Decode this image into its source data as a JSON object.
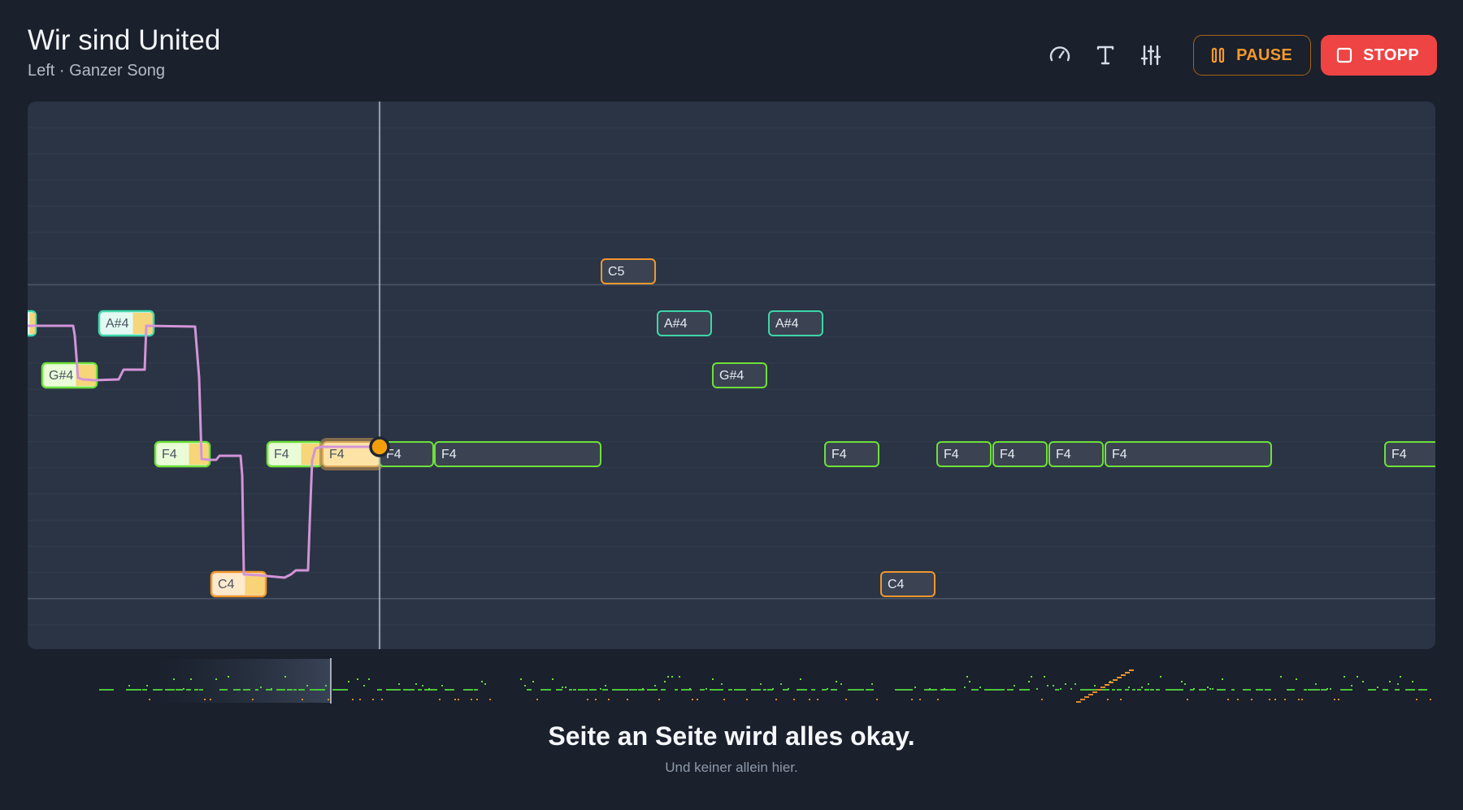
{
  "song": {
    "title": "Wir sind United",
    "subtitle": "Left · Ganzer Song"
  },
  "toolbar": {
    "speed_icon": "gauge-icon",
    "text_icon": "text-icon",
    "mixer_icon": "sliders-icon",
    "pause_label": "PAUSE",
    "stop_label": "STOPP"
  },
  "colors": {
    "background": "#1a202c",
    "roll_background": "#2a3444",
    "pitch_line": "#d394d8",
    "cursor": "#f59e0b",
    "pause": "#f39a2c",
    "stop": "#ef4444",
    "note_green": "#6ee03a",
    "note_teal": "#3ed6a8",
    "note_orange": "#f0962e"
  },
  "notes": [
    {
      "label": "",
      "pitch": "A#4",
      "color": "teal",
      "state": "sung"
    },
    {
      "label": "A#4",
      "pitch": "A#4",
      "color": "teal",
      "state": "sung"
    },
    {
      "label": "G#4",
      "pitch": "G#4",
      "color": "green",
      "state": "sung"
    },
    {
      "label": "F4",
      "pitch": "F4",
      "color": "green",
      "state": "sung"
    },
    {
      "label": "C4",
      "pitch": "C4",
      "color": "orange",
      "state": "sung"
    },
    {
      "label": "F4",
      "pitch": "F4",
      "color": "green",
      "state": "sung"
    },
    {
      "label": "F4",
      "pitch": "F4",
      "color": "orange",
      "state": "active"
    },
    {
      "label": "F4",
      "pitch": "F4",
      "color": "green",
      "state": "upcoming"
    },
    {
      "label": "F4",
      "pitch": "F4",
      "color": "green",
      "state": "upcoming"
    },
    {
      "label": "C5",
      "pitch": "C5",
      "color": "orange",
      "state": "upcoming"
    },
    {
      "label": "A#4",
      "pitch": "A#4",
      "color": "teal",
      "state": "upcoming"
    },
    {
      "label": "G#4",
      "pitch": "G#4",
      "color": "green",
      "state": "upcoming"
    },
    {
      "label": "A#4",
      "pitch": "A#4",
      "color": "teal",
      "state": "upcoming"
    },
    {
      "label": "F4",
      "pitch": "F4",
      "color": "green",
      "state": "upcoming"
    },
    {
      "label": "C4",
      "pitch": "C4",
      "color": "orange",
      "state": "upcoming"
    },
    {
      "label": "F4",
      "pitch": "F4",
      "color": "green",
      "state": "upcoming"
    },
    {
      "label": "F4",
      "pitch": "F4",
      "color": "green",
      "state": "upcoming"
    },
    {
      "label": "F4",
      "pitch": "F4",
      "color": "green",
      "state": "upcoming"
    },
    {
      "label": "F4",
      "pitch": "F4",
      "color": "green",
      "state": "upcoming"
    },
    {
      "label": "F4",
      "pitch": "F4",
      "color": "green",
      "state": "upcoming"
    }
  ],
  "lyrics": {
    "current": "Seite an Seite wird alles okay.",
    "next": "Und keiner allein hier."
  }
}
